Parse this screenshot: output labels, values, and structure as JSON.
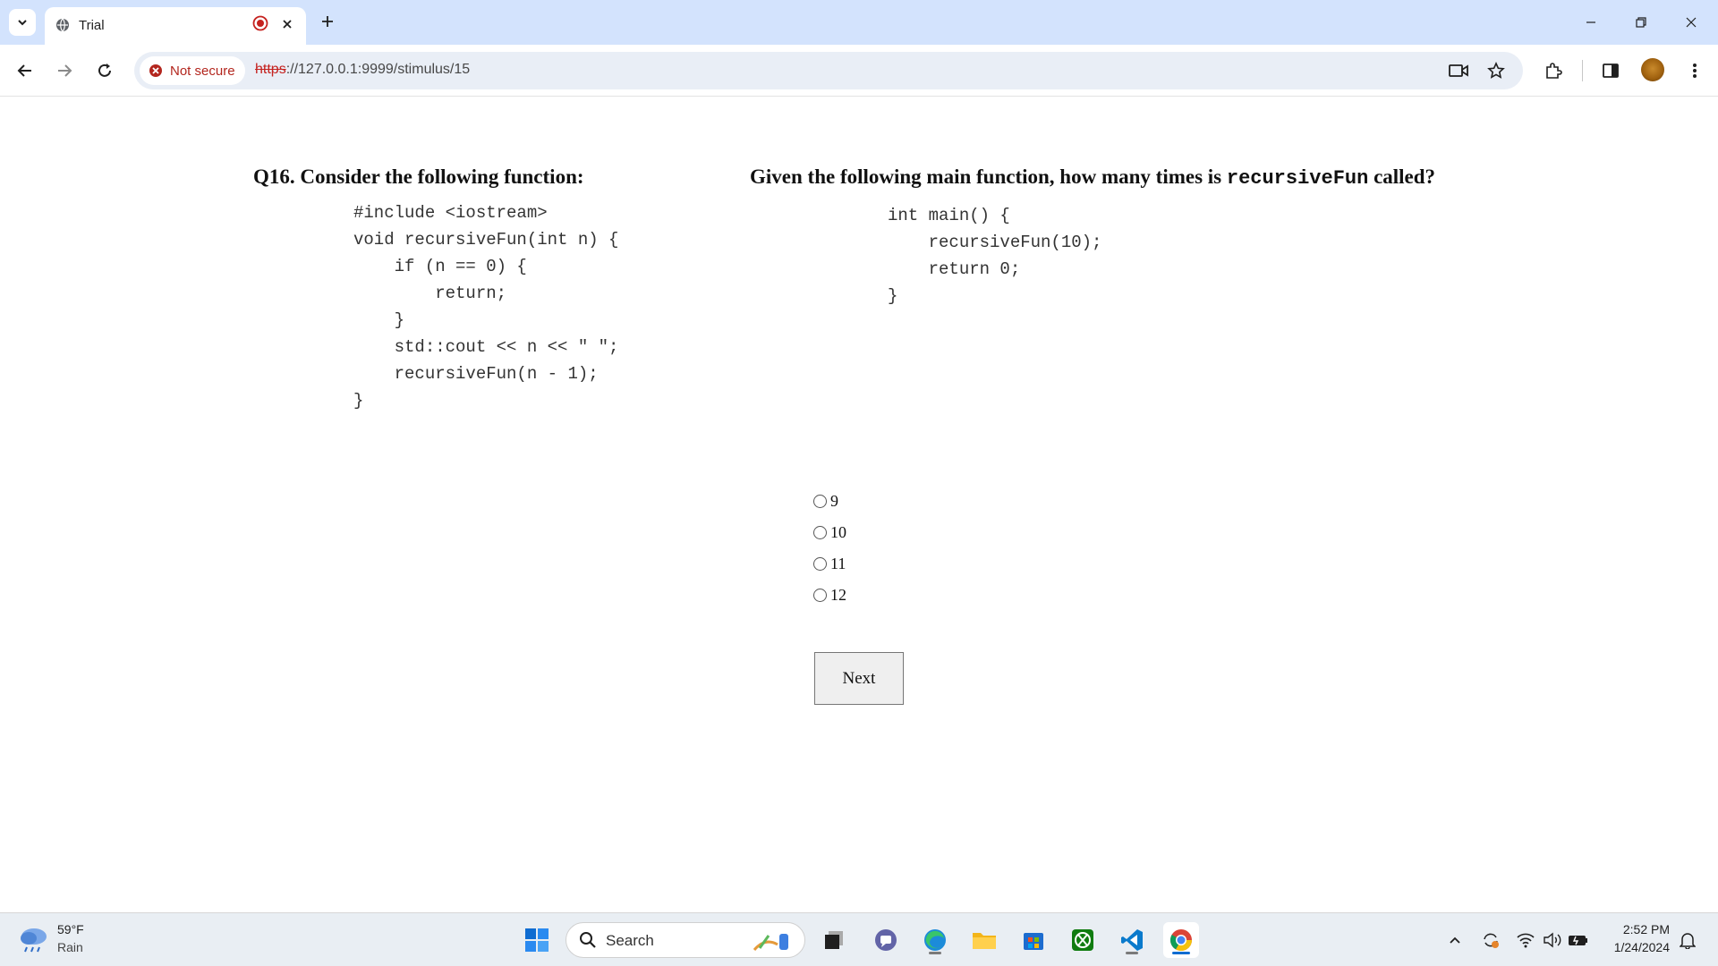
{
  "browser": {
    "tab_title": "Trial",
    "security_label": "Not secure",
    "url_scheme": "https",
    "url_rest": "://127.0.0.1:9999/stimulus/15"
  },
  "left_question": {
    "heading": "Q16. Consider the following function:",
    "code_lines": [
      "#include <iostream>",
      "void recursiveFun(int n) {",
      "    if (n == 0) {",
      "        return;",
      "    }",
      "    std::cout << n << \" \";",
      "    recursiveFun(n - 1);",
      "}"
    ]
  },
  "right_question": {
    "heading_prefix": "Given the following main function, how many times is",
    "heading_code": "recursiveFun",
    "heading_suffix": "called?",
    "code_lines": [
      "int main() {",
      "    recursiveFun(10);",
      "    return 0;",
      "}"
    ]
  },
  "options": [
    {
      "label": "9",
      "selected": false
    },
    {
      "label": "10",
      "selected": false
    },
    {
      "label": "11",
      "selected": false
    },
    {
      "label": "12",
      "selected": false
    }
  ],
  "next_label": "Next",
  "taskbar": {
    "weather_temp": "59°F",
    "weather_condition": "Rain",
    "search_label": "Search",
    "time": "2:52 PM",
    "date": "1/24/2024"
  },
  "colors": {
    "tab_strip": "#d3e3fd",
    "omnibox": "#e9eef6",
    "not_secure": "#b3261e"
  }
}
